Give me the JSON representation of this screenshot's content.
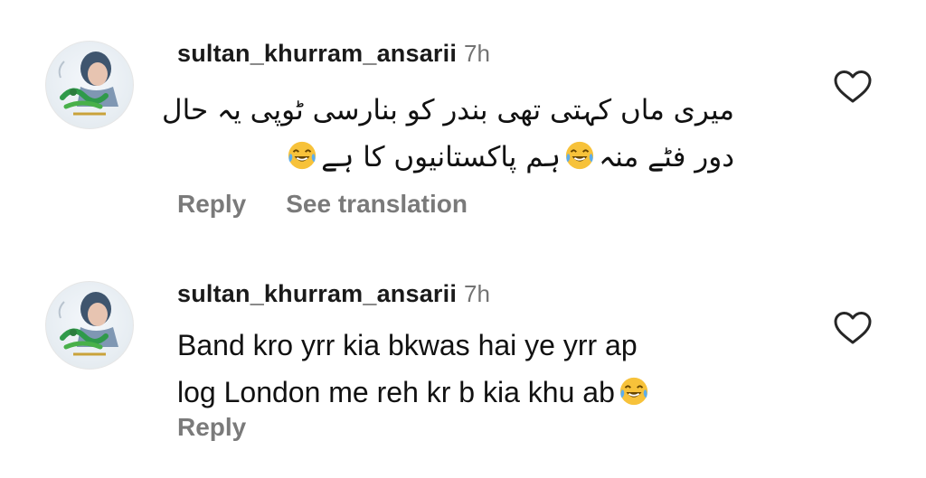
{
  "comments": [
    {
      "username": "sultan_khurram_ansarii",
      "time": "7h",
      "lines": [
        "میری ماں کہتی تھی بندر کو بنارسی ٹوپی یہ حال",
        "دور فٹے منہ",
        "ہم پاکستانیوں کا ہے"
      ],
      "emoji": "face-with-tears-of-joy",
      "actions": {
        "reply": "Reply",
        "translate": "See translation"
      }
    },
    {
      "username": "sultan_khurram_ansarii",
      "time": "7h",
      "lines": [
        "Band kro yrr kia bkwas hai ye yrr ap",
        "log London me reh kr b kia khu ab"
      ],
      "emoji": "face-with-tears-of-joy",
      "actions": {
        "reply": "Reply"
      }
    }
  ],
  "colors": {
    "username": "#1a1a1a",
    "secondary": "#737373",
    "action": "#7a7a7a",
    "emoji_face": "#f7c23a"
  },
  "icons": {
    "like": "heart-outline-icon",
    "emoji": "face-with-tears-of-joy-icon"
  }
}
